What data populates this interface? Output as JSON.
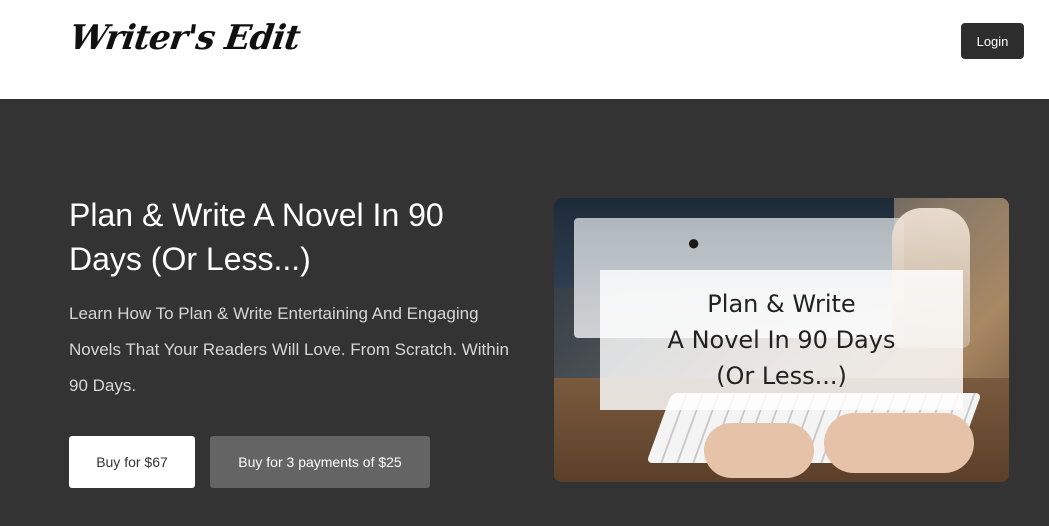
{
  "header": {
    "logo_text": "Writer's Edit",
    "login_label": "Login"
  },
  "hero": {
    "title": "Plan & Write A Novel In 90 Days (Or Less...)",
    "subtitle": "Learn How To Plan & Write Entertaining And Engaging Novels That Your Readers Will Love. From Scratch. Within 90 Days.",
    "buy_one_label": "Buy for $67",
    "buy_installments_label": "Buy for 3 payments of $25"
  },
  "promo_image": {
    "line1": "Plan & Write",
    "line2": "A Novel In 90 Days",
    "line3": "(Or Less...)",
    "apple_icon": "apple-logo-icon"
  }
}
